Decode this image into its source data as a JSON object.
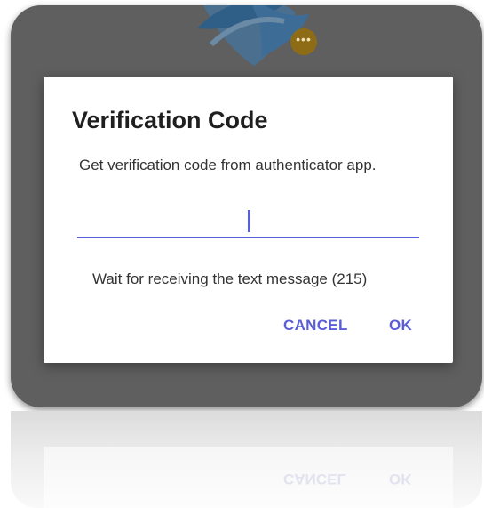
{
  "background": {
    "overlay_color": "#5f5f5f",
    "badge_icon": "more-horizontal-icon",
    "logo_icon": "shield-logo-icon"
  },
  "dialog": {
    "title": "Verification Code",
    "message": "Get verification code from authenticator app.",
    "code_input": {
      "value": "",
      "placeholder": ""
    },
    "wait_text": "Wait for receiving the text message (215)",
    "buttons": {
      "cancel": "CANCEL",
      "ok": "OK"
    },
    "accent_color": "#5b5ed9"
  }
}
